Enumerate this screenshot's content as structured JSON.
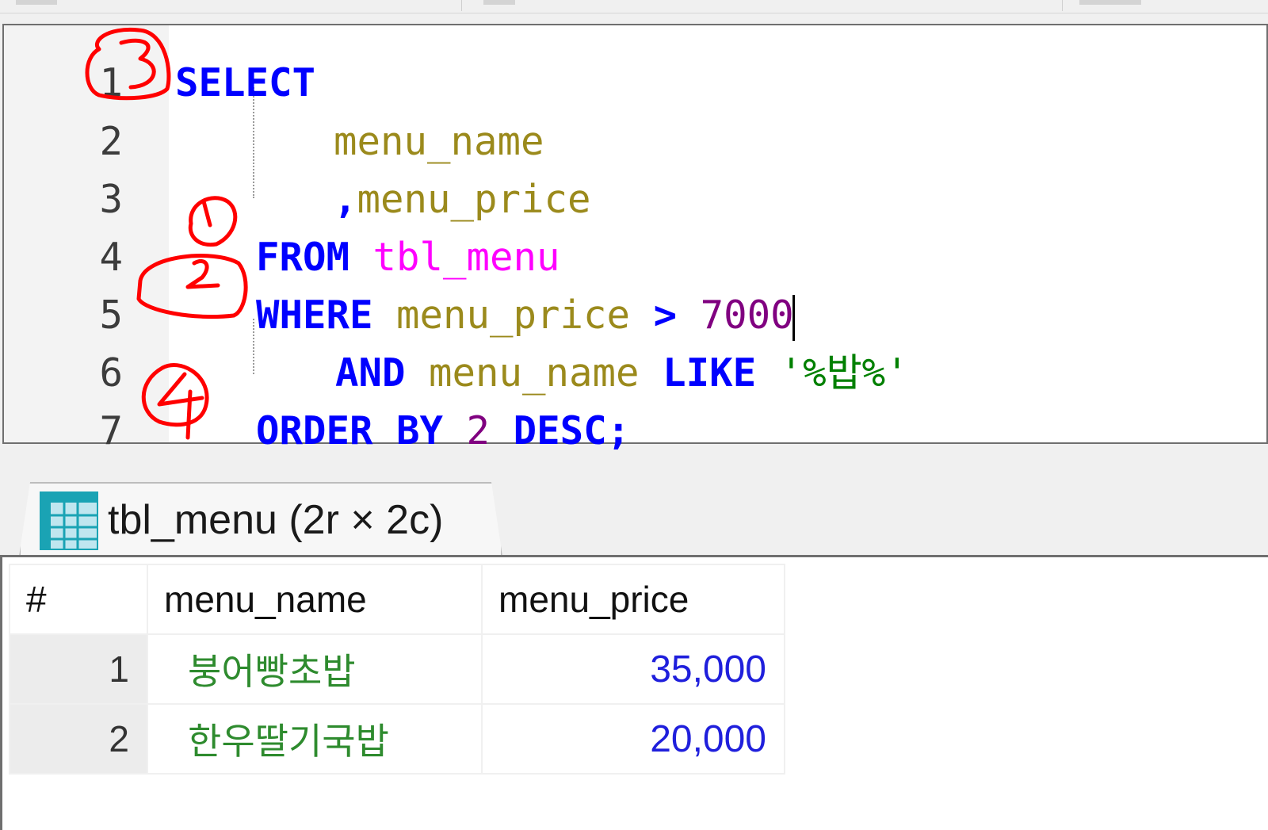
{
  "editor": {
    "lines": [
      {
        "num": "1",
        "tokens": [
          [
            "kw",
            "SELECT"
          ]
        ]
      },
      {
        "num": "2",
        "tokens": [
          [
            "col",
            "menu_name"
          ]
        ]
      },
      {
        "num": "3",
        "tokens": [
          [
            "punc",
            ","
          ],
          [
            "col",
            "menu_price"
          ]
        ]
      },
      {
        "num": "4",
        "tokens": [
          [
            "kw",
            "FROM"
          ],
          [
            "sp",
            " "
          ],
          [
            "tbl",
            "tbl_menu"
          ]
        ]
      },
      {
        "num": "5",
        "tokens": [
          [
            "kw",
            "WHERE"
          ],
          [
            "sp",
            " "
          ],
          [
            "col",
            "menu_price"
          ],
          [
            "sp",
            " "
          ],
          [
            "punc",
            ">"
          ],
          [
            "sp",
            " "
          ],
          [
            "num",
            "7000"
          ]
        ]
      },
      {
        "num": "6",
        "tokens": [
          [
            "kw",
            "AND"
          ],
          [
            "sp",
            " "
          ],
          [
            "col",
            "menu_name"
          ],
          [
            "sp",
            " "
          ],
          [
            "kw",
            "LIKE"
          ],
          [
            "sp",
            " "
          ],
          [
            "str",
            "'%밥%'"
          ]
        ]
      },
      {
        "num": "7",
        "tokens": [
          [
            "kw",
            "ORDER BY"
          ],
          [
            "sp",
            " "
          ],
          [
            "num",
            "2"
          ],
          [
            "sp",
            " "
          ],
          [
            "kw",
            "DESC"
          ],
          [
            "punc",
            ";"
          ]
        ]
      }
    ],
    "annotations": [
      "3",
      "1",
      "2",
      "4"
    ]
  },
  "result_tab": {
    "label": "tbl_menu (2r × 2c)",
    "icon": "table-grid-icon"
  },
  "grid": {
    "columns": [
      "#",
      "menu_name",
      "menu_price"
    ],
    "rows": [
      {
        "row_num": "1",
        "menu_name": "붕어빵초밥",
        "menu_price": "35,000"
      },
      {
        "row_num": "2",
        "menu_name": "한우딸기국밥",
        "menu_price": "20,000"
      }
    ]
  },
  "colors": {
    "keyword": "#0000ff",
    "column": "#9b8a1c",
    "table": "#ff00ff",
    "number": "#800080",
    "string": "#008000",
    "annotation": "#ff0000",
    "result_text": "#2e8b2e",
    "result_number": "#1f1fdc"
  }
}
